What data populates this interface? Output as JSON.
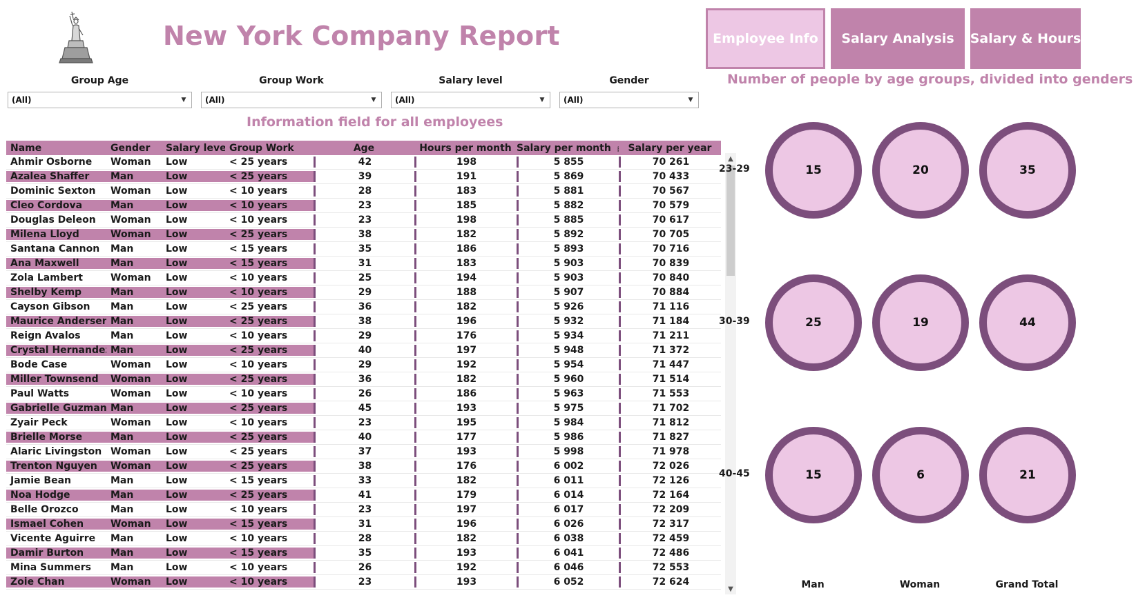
{
  "header": {
    "title": "New York Company Report",
    "logo_icon": "statue-of-liberty-icon"
  },
  "nav": [
    {
      "label": "Employee Info",
      "active": true
    },
    {
      "label": "Salary Analysis",
      "active": false
    },
    {
      "label": "Salary & Hours",
      "active": false
    }
  ],
  "filters": [
    {
      "label": "Group Age",
      "value": "(All)"
    },
    {
      "label": "Group Work",
      "value": "(All)"
    },
    {
      "label": "Salary level",
      "value": "(All)"
    },
    {
      "label": "Gender",
      "value": "(All)"
    }
  ],
  "table_title": "Information field for all employees",
  "table": {
    "columns": [
      "Name",
      "Gender",
      "Salary level",
      "Group Work",
      "Age",
      "Hours per month",
      "Salary per month",
      "Salary per year"
    ],
    "sort_indicator_column": "Salary per month",
    "rows": [
      [
        "Ahmir Osborne",
        "Woman",
        "Low",
        "< 25 years",
        "42",
        "198",
        "5 855",
        "70 261"
      ],
      [
        "Azalea Shaffer",
        "Man",
        "Low",
        "< 25 years",
        "39",
        "191",
        "5 869",
        "70 433"
      ],
      [
        "Dominic Sexton",
        "Woman",
        "Low",
        "< 10 years",
        "28",
        "183",
        "5 881",
        "70 567"
      ],
      [
        "Cleo Cordova",
        "Man",
        "Low",
        "< 10 years",
        "23",
        "185",
        "5 882",
        "70 579"
      ],
      [
        "Douglas Deleon",
        "Woman",
        "Low",
        "< 10 years",
        "23",
        "198",
        "5 885",
        "70 617"
      ],
      [
        "Milena Lloyd",
        "Woman",
        "Low",
        "< 25 years",
        "38",
        "182",
        "5 892",
        "70 705"
      ],
      [
        "Santana Cannon",
        "Man",
        "Low",
        "< 15 years",
        "35",
        "186",
        "5 893",
        "70 716"
      ],
      [
        "Ana Maxwell",
        "Man",
        "Low",
        "< 15 years",
        "31",
        "183",
        "5 903",
        "70 839"
      ],
      [
        "Zola Lambert",
        "Woman",
        "Low",
        "< 10 years",
        "25",
        "194",
        "5 903",
        "70 840"
      ],
      [
        "Shelby Kemp",
        "Man",
        "Low",
        "< 10 years",
        "29",
        "188",
        "5 907",
        "70 884"
      ],
      [
        "Cayson Gibson",
        "Man",
        "Low",
        "< 25 years",
        "36",
        "182",
        "5 926",
        "71 116"
      ],
      [
        "Maurice Andersen",
        "Man",
        "Low",
        "< 25 years",
        "38",
        "196",
        "5 932",
        "71 184"
      ],
      [
        "Reign Avalos",
        "Man",
        "Low",
        "< 10 years",
        "29",
        "176",
        "5 934",
        "71 211"
      ],
      [
        "Crystal Hernandez",
        "Man",
        "Low",
        "< 25 years",
        "40",
        "197",
        "5 948",
        "71 372"
      ],
      [
        "Bode Case",
        "Woman",
        "Low",
        "< 10 years",
        "29",
        "192",
        "5 954",
        "71 447"
      ],
      [
        "Miller Townsend",
        "Woman",
        "Low",
        "< 25 years",
        "36",
        "182",
        "5 960",
        "71 514"
      ],
      [
        "Paul Watts",
        "Woman",
        "Low",
        "< 10 years",
        "26",
        "186",
        "5 963",
        "71 553"
      ],
      [
        "Gabrielle Guzman",
        "Man",
        "Low",
        "< 25 years",
        "45",
        "193",
        "5 975",
        "71 702"
      ],
      [
        "Zyair Peck",
        "Woman",
        "Low",
        "< 10 years",
        "23",
        "195",
        "5 984",
        "71 812"
      ],
      [
        "Brielle Morse",
        "Man",
        "Low",
        "< 25 years",
        "40",
        "177",
        "5 986",
        "71 827"
      ],
      [
        "Alaric Livingston",
        "Woman",
        "Low",
        "< 25 years",
        "37",
        "193",
        "5 998",
        "71 978"
      ],
      [
        "Trenton Nguyen",
        "Woman",
        "Low",
        "< 25 years",
        "38",
        "176",
        "6 002",
        "72 026"
      ],
      [
        "Jamie Bean",
        "Man",
        "Low",
        "< 15 years",
        "33",
        "182",
        "6 011",
        "72 126"
      ],
      [
        "Noa Hodge",
        "Man",
        "Low",
        "< 25 years",
        "41",
        "179",
        "6 014",
        "72 164"
      ],
      [
        "Belle Orozco",
        "Man",
        "Low",
        "< 10 years",
        "23",
        "197",
        "6 017",
        "72 209"
      ],
      [
        "Ismael Cohen",
        "Woman",
        "Low",
        "< 15 years",
        "31",
        "196",
        "6 026",
        "72 317"
      ],
      [
        "Vicente Aguirre",
        "Man",
        "Low",
        "< 10 years",
        "28",
        "182",
        "6 038",
        "72 459"
      ],
      [
        "Damir Burton",
        "Man",
        "Low",
        "< 15 years",
        "35",
        "193",
        "6 041",
        "72 486"
      ],
      [
        "Mina Summers",
        "Man",
        "Low",
        "< 10 years",
        "26",
        "192",
        "6 046",
        "72 553"
      ],
      [
        "Zoie Chan",
        "Woman",
        "Low",
        "< 10 years",
        "23",
        "193",
        "6 052",
        "72 624"
      ]
    ]
  },
  "chart_title": "Number of people by age groups, divided into genders",
  "chart_data": {
    "type": "table",
    "title": "Number of people by age groups, divided into genders",
    "rows": [
      "23-29",
      "30-39",
      "40-45"
    ],
    "columns": [
      "Man",
      "Woman",
      "Grand Total"
    ],
    "values": [
      [
        15,
        20,
        35
      ],
      [
        25,
        19,
        44
      ],
      [
        15,
        6,
        21
      ]
    ]
  },
  "colors": {
    "accent": "#c083ab",
    "accent_light": "#edc7e4",
    "ring": "#7c4e7c"
  }
}
